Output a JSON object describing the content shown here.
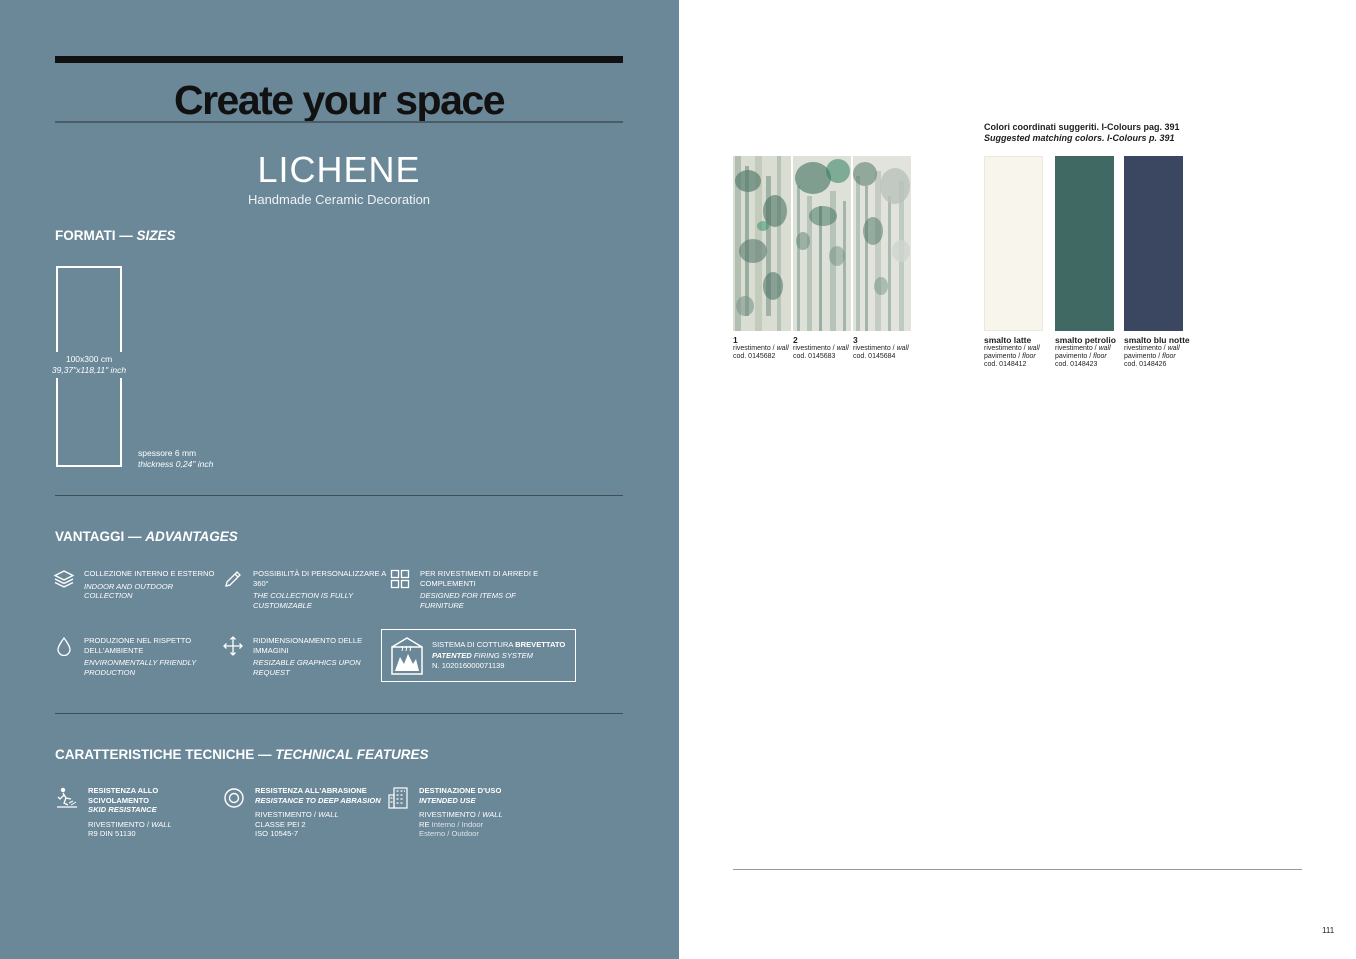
{
  "page": {
    "title": "Create your space",
    "product_name": "LICHENE",
    "product_subtitle": "Handmade Ceramic Decoration",
    "page_number": "111",
    "colors": {
      "left_panel": "#6b8899",
      "title_bar": "#111111",
      "swatch_latte": "#f8f5ec",
      "swatch_petrolio": "#3f6962",
      "swatch_blu_notte": "#3b4761"
    }
  },
  "sizes": {
    "heading_it": "FORMATI — ",
    "heading_en": "SIZES",
    "size_cm": "100x300 cm",
    "size_inch": "39,37\"x118,11\" inch",
    "thickness_it": "spessore 6 mm",
    "thickness_en": "thickness 0,24\" inch"
  },
  "advantages": {
    "heading_it": "VANTAGGI — ",
    "heading_en": "ADVANTAGES",
    "items": [
      {
        "icon": "layers-icon",
        "it": "COLLEZIONE INTERNO E ESTERNO",
        "en": "INDOOR AND OUTDOOR COLLECTION"
      },
      {
        "icon": "pencil-icon",
        "it": "POSSIBILITÀ DI PERSONALIZZARE A 360°",
        "en": "THE COLLECTION IS FULLY CUSTOMIZABLE"
      },
      {
        "icon": "grid-icon",
        "it": "PER RIVESTIMENTI DI ARREDI E COMPLEMENTI",
        "en": "DESIGNED FOR ITEMS OF FURNITURE"
      },
      {
        "icon": "drop-icon",
        "it": "PRODUZIONE NEL RISPETTO DELL'AMBIENTE",
        "en": "ENVIRONMENTALLY FRIENDLY PRODUCTION"
      },
      {
        "icon": "move-arrows-icon",
        "it": "RIDIMENSIONAMENTO DELLE IMMAGINI",
        "en": "RESIZABLE GRAPHICS UPON REQUEST"
      }
    ],
    "patent": {
      "icon": "kiln-icon",
      "line1_a": "SISTEMA DI COTTURA ",
      "line1_b": "BREVETTATO",
      "line2_a": "PATENTED",
      "line2_b": " FIRING SYSTEM",
      "line3": "N. 102016000071139"
    }
  },
  "technical": {
    "heading_it": "CARATTERISTICHE TECNICHE — ",
    "heading_en": "TECHNICAL FEATURES",
    "items": [
      {
        "icon": "slip-icon",
        "title_1": "RESISTENZA ALLO",
        "title_2": "SCIVOLAMENTO",
        "title_en": "SKID RESISTANCE",
        "val1_a": "RIVESTIMENTO / ",
        "val1_b": "WALL",
        "val2": "R9 DIN 51130"
      },
      {
        "icon": "abrasion-icon",
        "title_1": "RESISTENZA ALL'ABRASIONE",
        "title_en": "RESISTANCE TO DEEP ABRASION",
        "val1_a": "RIVESTIMENTO / ",
        "val1_b": "WALL",
        "val2": "CLASSE PEI 2",
        "val3": "ISO 10545-7"
      },
      {
        "icon": "building-icon",
        "title_1": "DESTINAZIONE D'USO",
        "title_en": "INTENDED USE",
        "val1_a": "RIVESTIMENTO / ",
        "val1_b": "WALL",
        "val2_a": "RE ",
        "val2_b": "Interno / Indoor",
        "val3": "Esterno / Outdoor"
      }
    ]
  },
  "matching": {
    "title_it": "Colori coordinati suggeriti. I-Colours pag. 391",
    "title_en": "Suggested matching colors. I-Colours p. 391"
  },
  "decorations": [
    {
      "num": "1",
      "use_a": "rivestimento / ",
      "use_b": "wall",
      "code": "cod. 0145682"
    },
    {
      "num": "2",
      "use_a": "rivestimento / ",
      "use_b": "wall",
      "code": "cod. 0145683"
    },
    {
      "num": "3",
      "use_a": "rivestimento / ",
      "use_b": "wall",
      "code": "cod. 0145684"
    }
  ],
  "swatches": [
    {
      "name": "smalto latte",
      "wall_a": "rivestimento / ",
      "wall_b": "wall",
      "floor_a": "pavimento / ",
      "floor_b": "floor",
      "code": "cod. 0148412"
    },
    {
      "name": "smalto petrolio",
      "wall_a": "rivestimento / ",
      "wall_b": "wall",
      "floor_a": "pavimento / ",
      "floor_b": "floor",
      "code": "cod. 0148423"
    },
    {
      "name": "smalto blu notte",
      "wall_a": "rivestimento / ",
      "wall_b": "wall",
      "floor_a": "pavimento / ",
      "floor_b": "floor",
      "code": "cod. 0148426"
    }
  ]
}
